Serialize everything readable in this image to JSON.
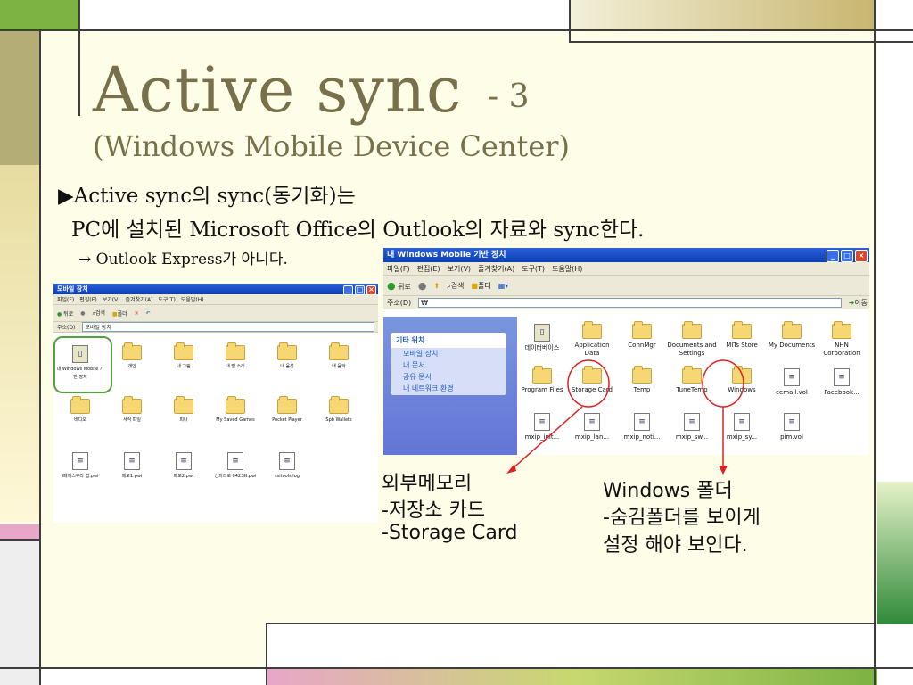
{
  "title": {
    "main": "Active sync",
    "suffix": "- 3",
    "subtitle": "(Windows Mobile Device Center)"
  },
  "body": {
    "line1": "▶Active sync의 sync(동기화)는",
    "line2": "PC에 설치된 Microsoft Office의 Outlook의 자료와 sync한다.",
    "line3": "→ Outlook Express가 아니다."
  },
  "left_window": {
    "title": "모바일 장치",
    "menu": [
      "파일(F)",
      "편집(E)",
      "보기(V)",
      "즐겨찾기(A)",
      "도구(T)",
      "도움말(H)"
    ],
    "toolbar": {
      "back": "뒤로",
      "search": "검색",
      "folders": "폴더"
    },
    "address_label": "주소(D)",
    "address_value": "모바일 장치",
    "items": [
      "내 Windows Mobile 기반 장치",
      "개인",
      "내 그림",
      "내 벨 소리",
      "내 음성",
      "내 음악",
      "비디오",
      "서식 파일",
      "피나",
      "My Saved Games",
      "Pocket Player",
      "Spb Wallets",
      "Ⅰ페이스구라 펍.pwi",
      "메모1.pwi",
      "메모2.pwi",
      "신의리로 0423ⅡⅠ.pwi",
      "ssitools.log"
    ]
  },
  "right_window": {
    "title": "내 Windows Mobile 기반 장치",
    "menu": [
      "파일(F)",
      "편집(E)",
      "보기(V)",
      "즐겨찾기(A)",
      "도구(T)",
      "도움말(H)"
    ],
    "toolbar": {
      "back": "뒤로",
      "search": "검색",
      "folders": "폴더"
    },
    "address_label": "주소(D)",
    "address_value": "₩",
    "go_label": "이동",
    "sidebar": {
      "heading": "기타 위치",
      "links": [
        "모바일 장치",
        "내 문서",
        "공유 문서",
        "내 네트워크 환경"
      ]
    },
    "items": [
      "데이터베이스",
      "Application Data",
      "ConnMgr",
      "Documents and Settings",
      "MITs Store",
      "My Documents",
      "NHN Corporation",
      "Program Files",
      "Storage Card",
      "Temp",
      "TuneTemp",
      "Windows",
      "cemail.vol",
      "Facebook...",
      "mxip_init...",
      "mxip_lan...",
      "mxip_noti...",
      "mxip_sw...",
      "mxip_sy...",
      "pim.vol"
    ]
  },
  "annotations": {
    "left": [
      "외부메모리",
      "-저장소 카드",
      "-Storage Card"
    ],
    "right": [
      "Windows 폴더",
      "-숨김폴더를 보이게",
      "설정 해야 보인다."
    ]
  },
  "colors": {
    "title": "#77704a",
    "background": "#fefde8",
    "arrow": "#e02020",
    "accent_green": "#2f8a3a",
    "accent_tan": "#c8b670"
  }
}
